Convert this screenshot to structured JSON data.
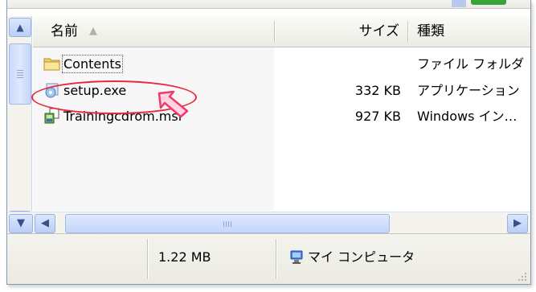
{
  "columns": {
    "name": "名前",
    "size": "サイズ",
    "type": "種類"
  },
  "files": [
    {
      "name": "Contents",
      "size": "",
      "type": "ファイル フォルダ",
      "icon": "folder-icon"
    },
    {
      "name": "setup.exe",
      "size": "332 KB",
      "type": "アプリケーション",
      "icon": "setup-exe-icon"
    },
    {
      "name": "Trainingcdrom.msi",
      "size": "927 KB",
      "type": "Windows イン…",
      "icon": "msi-package-icon"
    }
  ],
  "status": {
    "size_total": "1.22 MB",
    "location": "マイ コンピュータ"
  },
  "icons": {
    "sort": "sort-ascending-icon",
    "scroll_up": "scroll-up-icon",
    "scroll_down": "scroll-down-icon",
    "scroll_left": "scroll-left-icon",
    "scroll_right": "scroll-right-icon",
    "computer": "my-computer-icon"
  },
  "colors": {
    "highlight_ellipse": "#e8283c",
    "pointer_arrow": "#f03a6a",
    "scrollbar": "#c5d6fa"
  }
}
